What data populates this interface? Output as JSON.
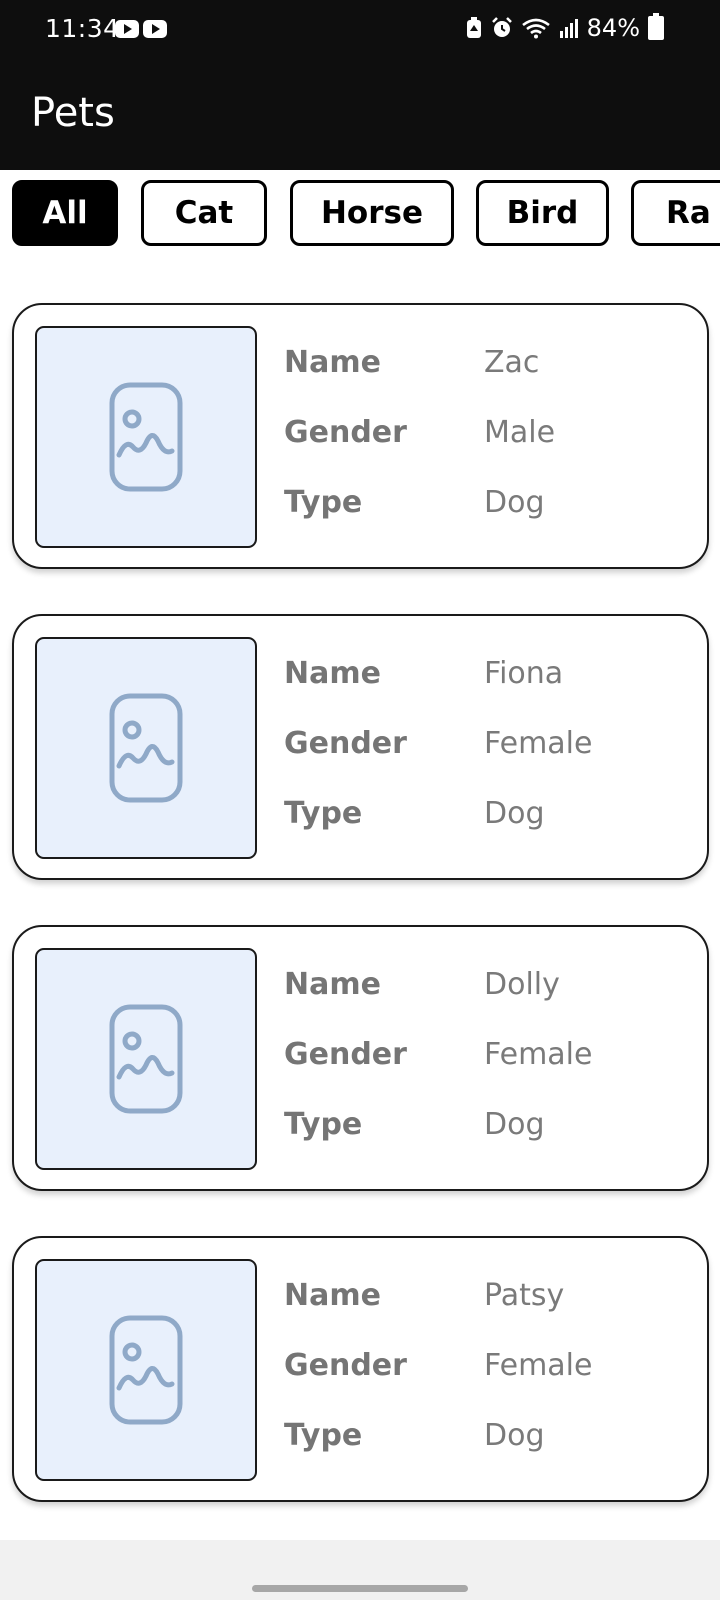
{
  "status_bar": {
    "time": "11:34",
    "battery": "84%",
    "icons": [
      "youtube-icon",
      "youtube-icon",
      "battery-saver-icon",
      "alarm-icon",
      "wifi-icon",
      "signal-icon",
      "battery-charging-icon"
    ]
  },
  "app_bar": {
    "title": "Pets"
  },
  "filters": [
    {
      "label": "All",
      "selected": true
    },
    {
      "label": "Cat",
      "selected": false
    },
    {
      "label": "Horse",
      "selected": false
    },
    {
      "label": "Bird",
      "selected": false
    },
    {
      "label": "Ra",
      "selected": false
    }
  ],
  "labels": {
    "name": "Name",
    "gender": "Gender",
    "type": "Type"
  },
  "pets": [
    {
      "name": "Zac",
      "gender": "Male",
      "type": "Dog",
      "image_icon": "image-placeholder-icon"
    },
    {
      "name": "Fiona",
      "gender": "Female",
      "type": "Dog",
      "image_icon": "image-placeholder-icon"
    },
    {
      "name": "Dolly",
      "gender": "Female",
      "type": "Dog",
      "image_icon": "image-placeholder-icon"
    },
    {
      "name": "Patsy",
      "gender": "Female",
      "type": "Dog",
      "image_icon": "image-placeholder-icon"
    }
  ],
  "colors": {
    "app_bar": "#0e0e0e",
    "chip_selected_bg": "#000000",
    "image_placeholder_bg": "#e8f0fc",
    "image_icon": "#8fa9c8",
    "text_muted": "#757575"
  }
}
